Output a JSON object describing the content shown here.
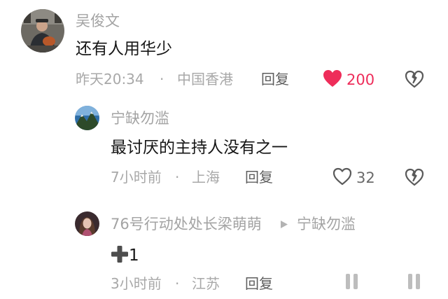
{
  "comments": [
    {
      "user": "吴俊文",
      "text": "还有人用华少",
      "time": "昨天20:34",
      "sep": "·",
      "location": "中国香港",
      "reply": "回复",
      "likes": "200",
      "liked": true
    },
    {
      "user": "宁缺勿滥",
      "text": "最讨厌的主持人没有之一",
      "time": "7小时前",
      "sep": "·",
      "location": "上海",
      "reply": "回复",
      "likes": "32",
      "liked": false
    },
    {
      "user": "76号行动处处长梁萌萌",
      "reply_to": "宁缺勿滥",
      "text": "1",
      "time": "3小时前",
      "sep": "·",
      "location": "江苏",
      "reply": "回复",
      "likes": "",
      "liked": false
    }
  ],
  "colors": {
    "like_active": "#ee2d5a",
    "muted": "#a3a3a3"
  },
  "icons": [
    "heart-filled-icon",
    "heart-outline-icon",
    "broken-heart-icon",
    "triangle-right-icon",
    "plus-icon",
    "pause-icon"
  ]
}
